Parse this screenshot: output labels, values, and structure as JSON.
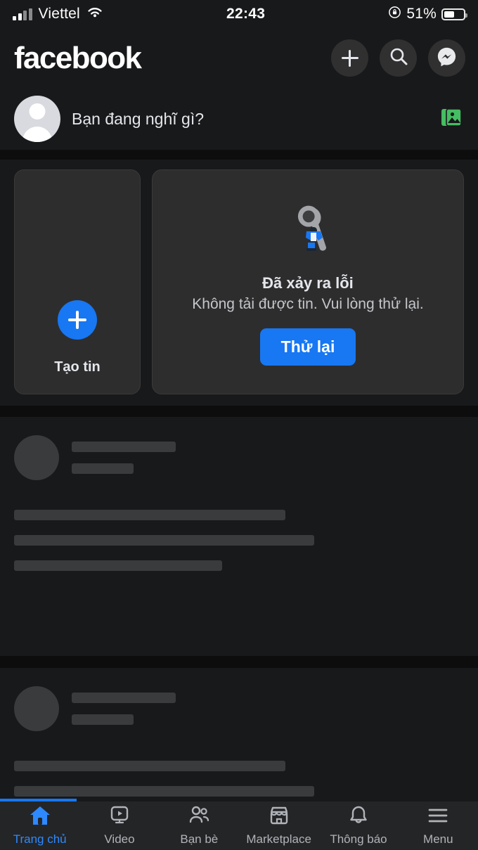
{
  "statusbar": {
    "carrier": "Viettel",
    "time": "22:43",
    "battery_percent": "51%",
    "signal_bars_filled": 2,
    "signal_bars_total": 4,
    "icons": [
      "signal-bars-icon",
      "wifi-icon",
      "rotation-lock-icon",
      "battery-icon"
    ]
  },
  "header": {
    "brand": "facebook",
    "actions": [
      {
        "name": "plus-button",
        "icon": "plus-icon"
      },
      {
        "name": "search-button",
        "icon": "search-icon"
      },
      {
        "name": "messenger-button",
        "icon": "messenger-icon"
      }
    ]
  },
  "composer": {
    "placeholder": "Bạn đang nghĩ gì?",
    "avatar": "default-user-avatar",
    "photo_icon": "photo-gallery-icon",
    "photo_icon_color": "#45bd62"
  },
  "stories": {
    "create_story": {
      "label": "Tạo tin",
      "icon": "plus-icon",
      "accent": "#1877f2"
    },
    "error": {
      "illustration": "wrench-worker-icon",
      "title": "Đã xảy ra lỗi",
      "subtitle": "Không tải được tin. Vui lòng thử lại.",
      "retry_label": "Thử lại",
      "retry_color": "#1877f2"
    }
  },
  "feed": {
    "placeholder_posts": [
      {
        "name_bar_width": 148,
        "meta_bar_width": 88,
        "body_bar_widths": [
          386,
          427,
          296
        ]
      },
      {
        "name_bar_width": 148,
        "meta_bar_width": 88,
        "body_bar_widths": [
          386,
          427
        ]
      }
    ]
  },
  "loading": {
    "progress_percent": 16,
    "color": "#1877f2"
  },
  "bottom_nav": {
    "active_index": 0,
    "active_color": "#2e89ff",
    "inactive_color": "#b0b3b8",
    "items": [
      {
        "label": "Trang chủ",
        "icon": "home-icon"
      },
      {
        "label": "Video",
        "icon": "video-icon"
      },
      {
        "label": "Bạn bè",
        "icon": "friends-icon"
      },
      {
        "label": "Marketplace",
        "icon": "marketplace-icon"
      },
      {
        "label": "Thông báo",
        "icon": "bell-icon"
      },
      {
        "label": "Menu",
        "icon": "hamburger-menu-icon"
      }
    ]
  }
}
